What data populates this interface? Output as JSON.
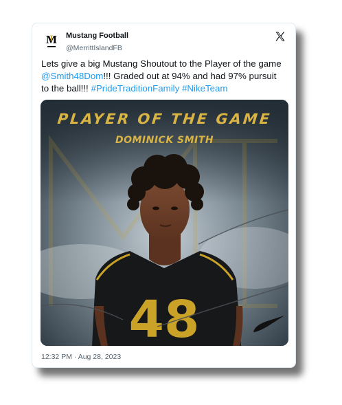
{
  "tweet": {
    "author_name": "Mustang Football",
    "author_handle": "@MerrittIslandFB",
    "text_before": "Lets give a big Mustang Shoutout to the Player of the game ",
    "mention": "@Smith48Dom",
    "text_after": "!!! Graded out at 94% and had 97% pursuit to the ball!!! ",
    "hashtag_1": "#PrideTraditionFamily",
    "hashtag_2": "#NikeTeam",
    "timestamp": "12:32 PM · Aug 28, 2023"
  },
  "poster": {
    "title": "PLAYER OF THE GAME",
    "player_name": "DOMINICK SMITH",
    "jersey_number": "48"
  },
  "icons": {
    "x_logo": "x-logo-icon",
    "team_logo": "mustang-logo-icon",
    "nike": "nike-swoosh-icon"
  },
  "colors": {
    "accent_link": "#1d9bf0",
    "poster_gold": "#d9b445",
    "text_primary": "#0f1419",
    "text_secondary": "#536471"
  }
}
